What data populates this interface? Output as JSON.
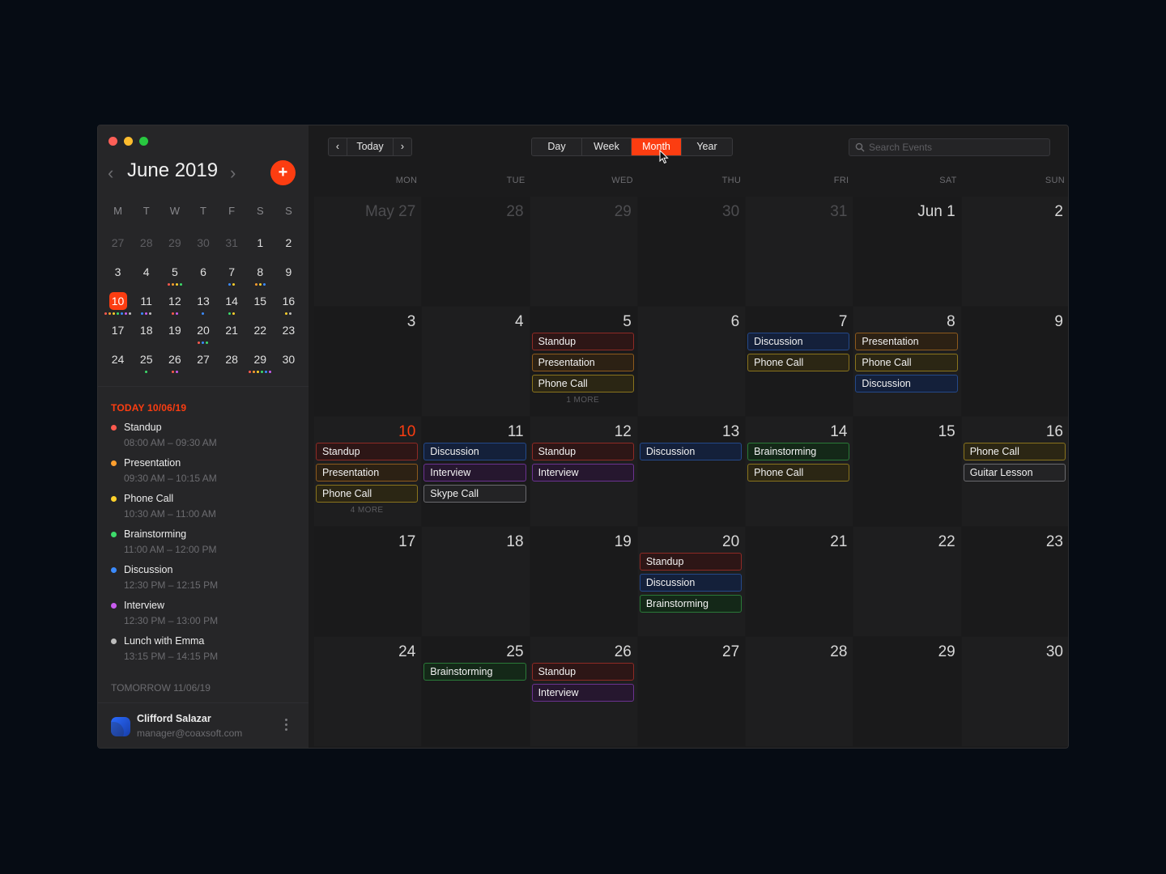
{
  "sidebar": {
    "month_title": "June 2019",
    "prev_icon": "‹",
    "next_icon": "›",
    "add_icon": "+",
    "weekday_headers": [
      "M",
      "T",
      "W",
      "T",
      "F",
      "S",
      "S"
    ],
    "days": [
      {
        "d": "27",
        "other": true,
        "dots": []
      },
      {
        "d": "28",
        "other": true,
        "dots": []
      },
      {
        "d": "29",
        "other": true,
        "dots": []
      },
      {
        "d": "30",
        "other": true,
        "dots": []
      },
      {
        "d": "31",
        "other": true,
        "dots": []
      },
      {
        "d": "1",
        "dots": []
      },
      {
        "d": "2",
        "dots": []
      },
      {
        "d": "3",
        "dots": []
      },
      {
        "d": "4",
        "dots": []
      },
      {
        "d": "5",
        "dots": [
          "#ff5a4e",
          "#ff9f2e",
          "#ffd12b",
          "#3ddc6b"
        ]
      },
      {
        "d": "6",
        "dots": []
      },
      {
        "d": "7",
        "dots": [
          "#3b8bff",
          "#ffd12b"
        ]
      },
      {
        "d": "8",
        "dots": [
          "#ff9f2e",
          "#ffd12b",
          "#3b8bff"
        ]
      },
      {
        "d": "9",
        "dots": []
      },
      {
        "d": "10",
        "today": true,
        "dots": [
          "#ff5a4e",
          "#ff9f2e",
          "#ffd12b",
          "#3ddc6b",
          "#3b8bff",
          "#c95cf0",
          "#bdbdbd"
        ]
      },
      {
        "d": "11",
        "dots": [
          "#3b8bff",
          "#c95cf0",
          "#bdbdbd"
        ]
      },
      {
        "d": "12",
        "dots": [
          "#ff5a4e",
          "#c95cf0"
        ]
      },
      {
        "d": "13",
        "dots": [
          "#3b8bff"
        ]
      },
      {
        "d": "14",
        "dots": [
          "#3ddc6b",
          "#ffd12b"
        ]
      },
      {
        "d": "15",
        "dots": []
      },
      {
        "d": "16",
        "dots": [
          "#ffd12b",
          "#bdbdbd"
        ]
      },
      {
        "d": "17",
        "dots": []
      },
      {
        "d": "18",
        "dots": []
      },
      {
        "d": "19",
        "dots": []
      },
      {
        "d": "20",
        "dots": [
          "#ff5a4e",
          "#3b8bff",
          "#3ddc6b"
        ]
      },
      {
        "d": "21",
        "dots": []
      },
      {
        "d": "22",
        "dots": []
      },
      {
        "d": "23",
        "dots": []
      },
      {
        "d": "24",
        "dots": []
      },
      {
        "d": "25",
        "dots": [
          "#3ddc6b"
        ]
      },
      {
        "d": "26",
        "dots": [
          "#ff5a4e",
          "#c95cf0"
        ]
      },
      {
        "d": "27",
        "dots": []
      },
      {
        "d": "28",
        "dots": []
      },
      {
        "d": "29",
        "dots": [
          "#ff5a4e",
          "#ff9f2e",
          "#ffd12b",
          "#3ddc6b",
          "#3b8bff",
          "#c95cf0"
        ]
      },
      {
        "d": "30",
        "dots": []
      }
    ],
    "today_heading": "TODAY 10/06/19",
    "agenda": [
      {
        "title": "Standup",
        "time": "08:00 AM – 09:30 AM",
        "color": "#ff5a4e"
      },
      {
        "title": "Presentation",
        "time": "09:30 AM – 10:15 AM",
        "color": "#ff9f2e"
      },
      {
        "title": "Phone Call",
        "time": "10:30 AM – 11:00 AM",
        "color": "#ffd12b"
      },
      {
        "title": "Brainstorming",
        "time": "11:00 AM – 12:00 PM",
        "color": "#3ddc6b"
      },
      {
        "title": "Discussion",
        "time": "12:30 PM – 12:15 PM",
        "color": "#3b8bff"
      },
      {
        "title": "Interview",
        "time": "12:30 PM – 13:00 PM",
        "color": "#c95cf0"
      },
      {
        "title": "Lunch with Emma",
        "time": "13:15 PM – 14:15 PM",
        "color": "#bdbdbd"
      }
    ],
    "tomorrow_heading": "TOMORROW 11/06/19",
    "user": {
      "name": "Clifford Salazar",
      "email": "manager@coaxsoft.com"
    }
  },
  "toolbar": {
    "prev_icon": "‹",
    "today_label": "Today",
    "next_icon": "›",
    "views": [
      {
        "label": "Day",
        "active": false
      },
      {
        "label": "Week",
        "active": false
      },
      {
        "label": "Month",
        "active": true
      },
      {
        "label": "Year",
        "active": false
      }
    ],
    "search_placeholder": "Search Events"
  },
  "calendar": {
    "weekdays": [
      "MON",
      "TUE",
      "WED",
      "THU",
      "FRI",
      "SAT",
      "SUN"
    ],
    "cells": [
      {
        "label": "May 27",
        "other": true,
        "events": []
      },
      {
        "label": "28",
        "other": true,
        "events": []
      },
      {
        "label": "29",
        "other": true,
        "events": []
      },
      {
        "label": "30",
        "other": true,
        "events": []
      },
      {
        "label": "31",
        "other": true,
        "events": []
      },
      {
        "label": "Jun 1",
        "events": []
      },
      {
        "label": "2",
        "events": []
      },
      {
        "label": "3",
        "events": []
      },
      {
        "label": "4",
        "events": []
      },
      {
        "label": "5",
        "events": [
          {
            "t": "Standup",
            "c": "red"
          },
          {
            "t": "Presentation",
            "c": "orange"
          },
          {
            "t": "Phone Call",
            "c": "yellow"
          }
        ],
        "more": "1 MORE"
      },
      {
        "label": "6",
        "events": []
      },
      {
        "label": "7",
        "events": [
          {
            "t": "Discussion",
            "c": "blue"
          },
          {
            "t": "Phone Call",
            "c": "yellow"
          }
        ]
      },
      {
        "label": "8",
        "events": [
          {
            "t": "Presentation",
            "c": "orange"
          },
          {
            "t": "Phone Call",
            "c": "yellow"
          },
          {
            "t": "Discussion",
            "c": "blue"
          }
        ]
      },
      {
        "label": "9",
        "events": []
      },
      {
        "label": "10",
        "today": true,
        "events": [
          {
            "t": "Standup",
            "c": "red"
          },
          {
            "t": "Presentation",
            "c": "orange"
          },
          {
            "t": "Phone Call",
            "c": "yellow"
          }
        ],
        "more": "4 MORE"
      },
      {
        "label": "11",
        "events": [
          {
            "t": "Discussion",
            "c": "blue"
          },
          {
            "t": "Interview",
            "c": "purple"
          },
          {
            "t": "Skype Call",
            "c": "gray"
          }
        ]
      },
      {
        "label": "12",
        "events": [
          {
            "t": "Standup",
            "c": "red"
          },
          {
            "t": "Interview",
            "c": "purple"
          }
        ]
      },
      {
        "label": "13",
        "events": [
          {
            "t": "Discussion",
            "c": "blue"
          }
        ]
      },
      {
        "label": "14",
        "events": [
          {
            "t": "Brainstorming",
            "c": "green"
          },
          {
            "t": "Phone Call",
            "c": "yellow"
          }
        ]
      },
      {
        "label": "15",
        "events": []
      },
      {
        "label": "16",
        "events": [
          {
            "t": "Phone Call",
            "c": "yellow"
          },
          {
            "t": "Guitar Lesson",
            "c": "gray"
          }
        ]
      },
      {
        "label": "17",
        "events": []
      },
      {
        "label": "18",
        "events": []
      },
      {
        "label": "19",
        "events": []
      },
      {
        "label": "20",
        "events": [
          {
            "t": "Standup",
            "c": "red"
          },
          {
            "t": "Discussion",
            "c": "blue"
          },
          {
            "t": "Brainstorming",
            "c": "green"
          }
        ]
      },
      {
        "label": "21",
        "events": []
      },
      {
        "label": "22",
        "events": []
      },
      {
        "label": "23",
        "events": []
      },
      {
        "label": "24",
        "events": []
      },
      {
        "label": "25",
        "events": [
          {
            "t": "Brainstorming",
            "c": "green"
          }
        ]
      },
      {
        "label": "26",
        "events": [
          {
            "t": "Standup",
            "c": "red"
          },
          {
            "t": "Interview",
            "c": "purple"
          }
        ]
      },
      {
        "label": "27",
        "events": []
      },
      {
        "label": "28",
        "events": []
      },
      {
        "label": "29",
        "events": []
      },
      {
        "label": "30",
        "events": []
      }
    ]
  },
  "event_colors": {
    "red": {
      "border": "#8f2a25",
      "bg": "#2d1616"
    },
    "orange": {
      "border": "#8d5a1d",
      "bg": "#2c2114"
    },
    "yellow": {
      "border": "#8a741d",
      "bg": "#2b2614"
    },
    "green": {
      "border": "#2a7a38",
      "bg": "#142818"
    },
    "blue": {
      "border": "#24498a",
      "bg": "#14203a"
    },
    "purple": {
      "border": "#6b3390",
      "bg": "#26172f"
    },
    "gray": {
      "border": "#6a6a6e",
      "bg": "#232325"
    }
  }
}
